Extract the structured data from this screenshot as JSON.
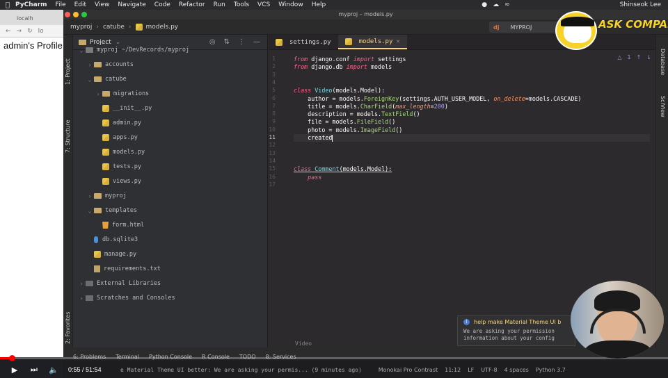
{
  "menubar": {
    "app": "PyCharm",
    "items": [
      "File",
      "Edit",
      "View",
      "Navigate",
      "Code",
      "Refactor",
      "Run",
      "Tools",
      "VCS",
      "Window",
      "Help"
    ],
    "user": "Shinseok Lee"
  },
  "browser": {
    "tab_title": "localh",
    "address": "lo",
    "page_text": "admin's Profile"
  },
  "window": {
    "title": "myproj – models.py"
  },
  "breadcrumbs": [
    "myproj",
    "catube",
    "models.py"
  ],
  "run_config": {
    "badge": "dj",
    "label": "MYPROJ"
  },
  "left_tools": {
    "project": "1: Project",
    "structure": "7: Structure",
    "favorites": "2: Favorites"
  },
  "right_tools": {
    "database": "Database",
    "sciview": "SciView"
  },
  "project_panel": {
    "title": "Project",
    "tree": [
      {
        "label": "myproj  ~/DevRecords/myproj",
        "type": "folder-dark",
        "depth": 0,
        "expanded": true
      },
      {
        "label": "accounts",
        "type": "folder",
        "depth": 1,
        "expanded": false
      },
      {
        "label": "catube",
        "type": "folder",
        "depth": 1,
        "expanded": true
      },
      {
        "label": "migrations",
        "type": "folder",
        "depth": 2,
        "expanded": false
      },
      {
        "label": "__init__.py",
        "type": "py",
        "depth": 2
      },
      {
        "label": "admin.py",
        "type": "py",
        "depth": 2
      },
      {
        "label": "apps.py",
        "type": "py",
        "depth": 2
      },
      {
        "label": "models.py",
        "type": "py",
        "depth": 2
      },
      {
        "label": "tests.py",
        "type": "py",
        "depth": 2
      },
      {
        "label": "views.py",
        "type": "py",
        "depth": 2
      },
      {
        "label": "myproj",
        "type": "folder",
        "depth": 1,
        "expanded": false
      },
      {
        "label": "templates",
        "type": "folder",
        "depth": 1,
        "expanded": true
      },
      {
        "label": "form.html",
        "type": "html",
        "depth": 2
      },
      {
        "label": "db.sqlite3",
        "type": "db",
        "depth": 1
      },
      {
        "label": "manage.py",
        "type": "py",
        "depth": 1
      },
      {
        "label": "requirements.txt",
        "type": "txt",
        "depth": 1
      },
      {
        "label": "External Libraries",
        "type": "lib",
        "depth": 0,
        "expanded": false
      },
      {
        "label": "Scratches and Consoles",
        "type": "lib",
        "depth": 0,
        "expanded": false
      }
    ]
  },
  "editor": {
    "tabs": [
      {
        "label": "settings.py",
        "active": false
      },
      {
        "label": "models.py",
        "active": true
      }
    ],
    "line_numbers": [
      "1",
      "2",
      "3",
      "4",
      "5",
      "6",
      "7",
      "8",
      "9",
      "10",
      "11",
      "12",
      "13",
      "14",
      "15",
      "16",
      "17"
    ],
    "current_line": "11",
    "inspection_count": "1",
    "structure_crumb": "Video",
    "lines": [
      {
        "n": "1",
        "tokens": [
          {
            "t": "from",
            "c": "kw"
          },
          {
            "t": " django.conf ",
            "c": ""
          },
          {
            "t": "import",
            "c": "kw"
          },
          {
            "t": " settings",
            "c": ""
          }
        ]
      },
      {
        "n": "2",
        "tokens": [
          {
            "t": "from",
            "c": "kw"
          },
          {
            "t": " django.db ",
            "c": ""
          },
          {
            "t": "import",
            "c": "kw"
          },
          {
            "t": " models",
            "c": ""
          }
        ]
      },
      {
        "n": "3",
        "tokens": []
      },
      {
        "n": "4",
        "tokens": []
      },
      {
        "n": "5",
        "tokens": [
          {
            "t": "class",
            "c": "kw"
          },
          {
            "t": " ",
            "c": ""
          },
          {
            "t": "Video",
            "c": "cls"
          },
          {
            "t": "(models.Model):",
            "c": ""
          }
        ]
      },
      {
        "n": "6",
        "tokens": [
          {
            "t": "    author = models.",
            "c": ""
          },
          {
            "t": "ForeignKey",
            "c": "fn"
          },
          {
            "t": "(settings.AUTH_USER_MODEL, ",
            "c": ""
          },
          {
            "t": "on_delete",
            "c": "par"
          },
          {
            "t": "=models.CASCADE)",
            "c": ""
          }
        ]
      },
      {
        "n": "7",
        "tokens": [
          {
            "t": "    title = models.",
            "c": ""
          },
          {
            "t": "CharField",
            "c": "fn"
          },
          {
            "t": "(",
            "c": ""
          },
          {
            "t": "max_length",
            "c": "par"
          },
          {
            "t": "=",
            "c": ""
          },
          {
            "t": "200",
            "c": "num"
          },
          {
            "t": ")",
            "c": ""
          }
        ]
      },
      {
        "n": "8",
        "tokens": [
          {
            "t": "    description = models.",
            "c": ""
          },
          {
            "t": "TextField",
            "c": "fn"
          },
          {
            "t": "()",
            "c": ""
          }
        ]
      },
      {
        "n": "9",
        "tokens": [
          {
            "t": "    file = models.",
            "c": ""
          },
          {
            "t": "FileField",
            "c": "fn"
          },
          {
            "t": "()",
            "c": ""
          }
        ]
      },
      {
        "n": "10",
        "tokens": [
          {
            "t": "    photo = models.",
            "c": ""
          },
          {
            "t": "ImageField",
            "c": "fn"
          },
          {
            "t": "()",
            "c": ""
          }
        ]
      },
      {
        "n": "11",
        "tokens": [
          {
            "t": "    created",
            "c": ""
          }
        ]
      },
      {
        "n": "12",
        "tokens": []
      },
      {
        "n": "13",
        "tokens": []
      },
      {
        "n": "14",
        "tokens": []
      },
      {
        "n": "15",
        "tokens": [
          {
            "t": "class",
            "c": "kw und"
          },
          {
            "t": " ",
            "c": "und"
          },
          {
            "t": "Comment",
            "c": "cls und"
          },
          {
            "t": "(models.Model):",
            "c": "und"
          }
        ]
      },
      {
        "n": "16",
        "tokens": [
          {
            "t": "    ",
            "c": ""
          },
          {
            "t": "pass",
            "c": "kw"
          }
        ]
      },
      {
        "n": "17",
        "tokens": []
      }
    ]
  },
  "notification": {
    "title": "help make Material Theme UI b",
    "body_1": "We are asking your permission",
    "body_2": "information about your config"
  },
  "tool_windows": [
    {
      "label": "6: Problems",
      "key": "problems-tool-button"
    },
    {
      "label": "Terminal",
      "key": "terminal-tool-button"
    },
    {
      "label": "Python Console",
      "key": "python-console-tool-button"
    },
    {
      "label": "R Console",
      "key": "r-console-tool-button"
    },
    {
      "label": "TODO",
      "key": "todo-tool-button"
    },
    {
      "label": "8: Services",
      "key": "services-tool-button"
    }
  ],
  "statusbar": {
    "message": "e Material Theme UI better: We are asking your permis... (9 minutes ago)",
    "theme": "Monokai Pro Contrast",
    "position": "11:12",
    "line_sep": "LF",
    "encoding": "UTF-8",
    "indent": "4 spaces",
    "interpreter": "Python 3.7"
  },
  "player": {
    "current_time": "0:55",
    "duration": "51:54",
    "progress": 0.018,
    "accent": "#ff0000"
  },
  "overlay": {
    "logo_text": "ASK COMPANY"
  }
}
